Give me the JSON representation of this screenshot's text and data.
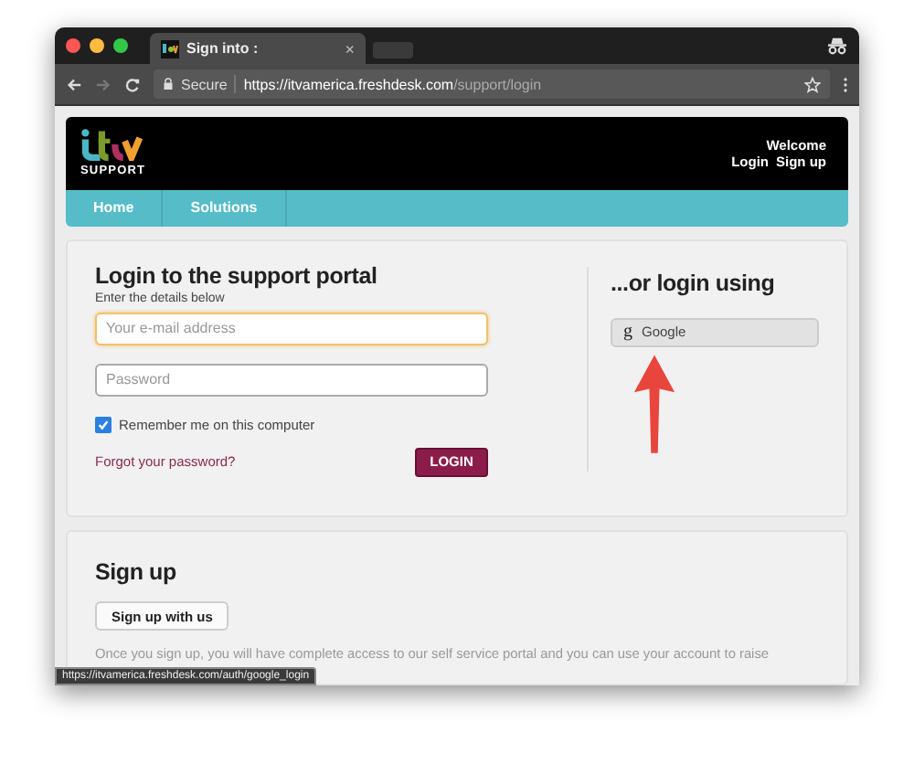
{
  "browser": {
    "tabs": [
      {
        "kind": "page",
        "title": "Sign into :",
        "close": "×",
        "selected": true
      },
      {
        "kind": "new_tab",
        "selected": false
      }
    ],
    "secure_label": "Secure",
    "url_host": "https://itvamerica.freshdesk.com",
    "url_path": "/support/login"
  },
  "header": {
    "logo_text": "SUPPORT",
    "welcome": "Welcome",
    "links": [
      "Login",
      "Sign up"
    ]
  },
  "nav": [
    {
      "label": "Home"
    },
    {
      "label": "Solutions"
    }
  ],
  "login": {
    "title": "Login to the support portal",
    "subtitle": "Enter the details below",
    "fields": [
      {
        "placeholder": "Your e-mail address",
        "focused": true
      },
      {
        "placeholder": "Password",
        "focused": false
      }
    ],
    "remember": {
      "label": "Remember me on this computer",
      "checked": true
    },
    "forgot": "Forgot your password?",
    "button": "LOGIN"
  },
  "social": {
    "title": "...or login using",
    "providers": [
      {
        "icon": "g",
        "label": "Google"
      }
    ]
  },
  "signup": {
    "title": "Sign up",
    "button": "Sign up with us",
    "text": "Once you sign up, you will have complete access to our self service portal and you can use your account to raise"
  },
  "status_url": "https://itvamerica.freshdesk.com/auth/google_login"
}
